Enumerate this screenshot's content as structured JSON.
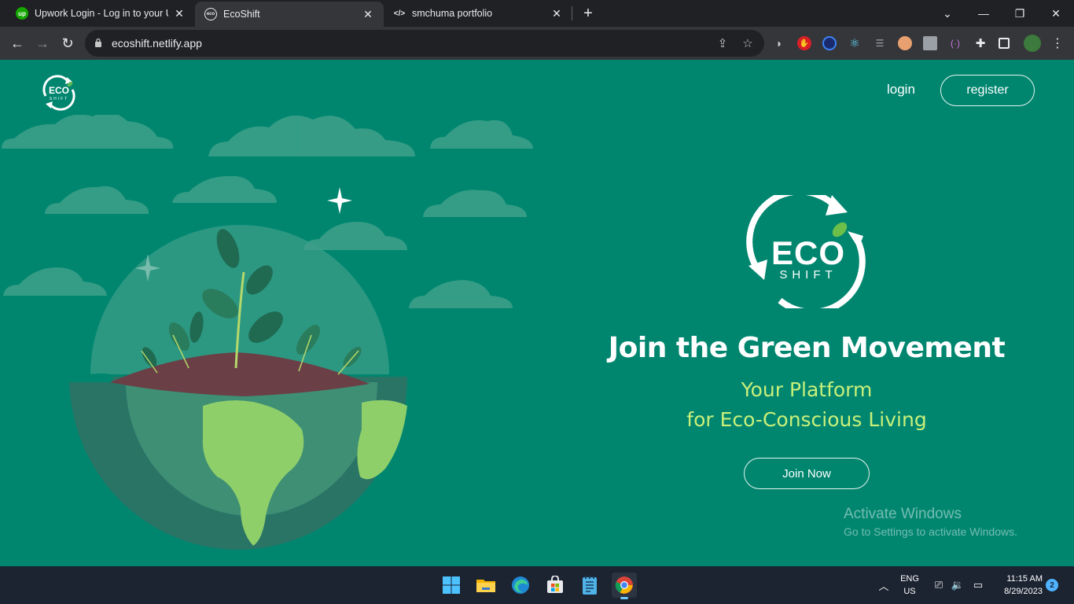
{
  "browser": {
    "tabs": [
      {
        "title": "Upwork Login - Log in to your Up",
        "icon": "upwork-icon"
      },
      {
        "title": "EcoShift",
        "icon": "ecoshift-icon",
        "active": true
      },
      {
        "title": "smchuma portfolio",
        "icon": "code-icon"
      }
    ],
    "url": "ecoshift.netlify.app"
  },
  "nav": {
    "login_label": "login",
    "register_label": "register"
  },
  "logo": {
    "top_text": "ECO",
    "bottom_text": "SHIFT"
  },
  "hero": {
    "title": "Join the Green Movement",
    "subtitle_line1": "Your Platform",
    "subtitle_line2": "for Eco-Conscious Living",
    "cta_label": "Join Now"
  },
  "watermark": {
    "line1": "Activate Windows",
    "line2": "Go to Settings to activate Windows."
  },
  "taskbar": {
    "language_line1": "ENG",
    "language_line2": "US",
    "time": "11:15 AM",
    "date": "8/29/2023",
    "notification_count": "2"
  },
  "colors": {
    "page_bg": "#00866f",
    "accent_text": "#c9f07a",
    "white": "#ffffff"
  }
}
